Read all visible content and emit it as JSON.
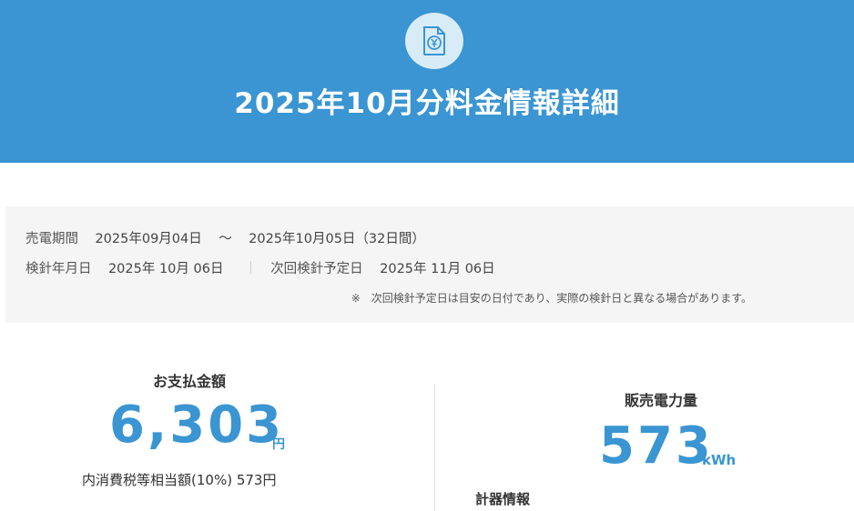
{
  "header": {
    "title": "2025年10月分料金情報詳細",
    "icon": "yen-document-icon"
  },
  "period": {
    "label": "売電期間",
    "start": "2025年09月04日",
    "tilde": "～",
    "end": "2025年10月05日（32日間）"
  },
  "meter_reading": {
    "label": "検針年月日",
    "date": "2025年 10月 06日",
    "separator": "｜",
    "next_label": "次回検針予定日",
    "next_date": "2025年 11月 06日"
  },
  "note": "※　次回検針予定日は目安の日付であり、実際の検針日と異なる場合があります。",
  "payment": {
    "label": "お支払金額",
    "amount": "6,303",
    "unit": "円",
    "tax_line": "内消費税等相当額(10%) 573円"
  },
  "sales": {
    "label": "販売電力量",
    "amount": "573",
    "unit": "kWh"
  },
  "meter_info_label": "計器情報",
  "colors": {
    "accent": "#3a95d2",
    "icon_bg": "#d8ecf8",
    "info_bg": "#f5f5f5"
  }
}
